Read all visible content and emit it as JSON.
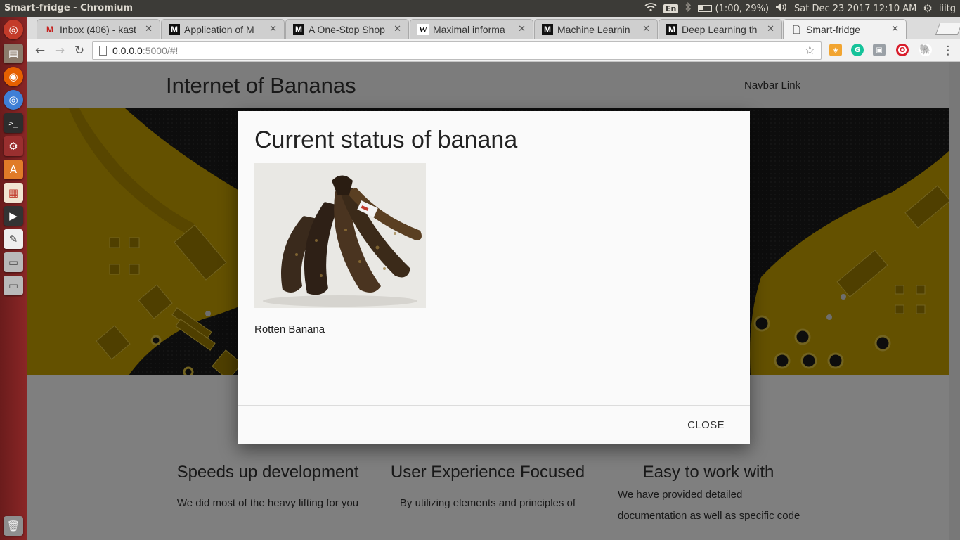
{
  "os": {
    "window_title": "Smart-fridge - Chromium",
    "lang": "En",
    "battery": "(1:00, 29%)",
    "clock": "Sat Dec 23 2017 12:10 AM",
    "user": "iiitg"
  },
  "launcher": {
    "icons": [
      "ubuntu-dash-icon",
      "files-icon",
      "firefox-icon",
      "chromium-icon",
      "terminal-icon",
      "settings-icon",
      "software-center-icon",
      "document-viewer-icon",
      "video-icon",
      "text-editor-icon",
      "drive-icon",
      "drive-icon",
      "trash-icon"
    ]
  },
  "tabs": [
    {
      "label": "Inbox (406) - kast",
      "favicon": "M",
      "icon": "gmail-icon"
    },
    {
      "label": "Application of M",
      "favicon": "M",
      "icon": "medium-icon"
    },
    {
      "label": "A One-Stop Shop",
      "favicon": "M",
      "icon": "medium-icon"
    },
    {
      "label": "Maximal informa",
      "favicon": "W",
      "icon": "wikipedia-icon"
    },
    {
      "label": "Machine Learnin",
      "favicon": "M",
      "icon": "medium-icon"
    },
    {
      "label": "Deep Learning th",
      "favicon": "M",
      "icon": "medium-icon"
    },
    {
      "label": "Smart-fridge",
      "favicon": "",
      "icon": "page-icon"
    }
  ],
  "address": {
    "host": "0.0.0.0",
    "path": ":5000/#!"
  },
  "page": {
    "brand": "Internet of Bananas",
    "nav_link": "Navbar Link",
    "features": [
      {
        "title": "Speeds up development",
        "text": "We did most of the heavy lifting for you"
      },
      {
        "title": "User Experience Focused",
        "text": "By utilizing elements and principles of"
      },
      {
        "title": "Easy to work with",
        "text": "We have provided detailed documentation as well as specific code"
      }
    ]
  },
  "modal": {
    "title": "Current status of banana",
    "caption": "Rotten Banana",
    "close_label": "CLOSE"
  },
  "colors": {
    "pcb_gold": "#c9a300",
    "pcb_dark": "#1b1b1b",
    "launcher": "#7a1f1f"
  }
}
